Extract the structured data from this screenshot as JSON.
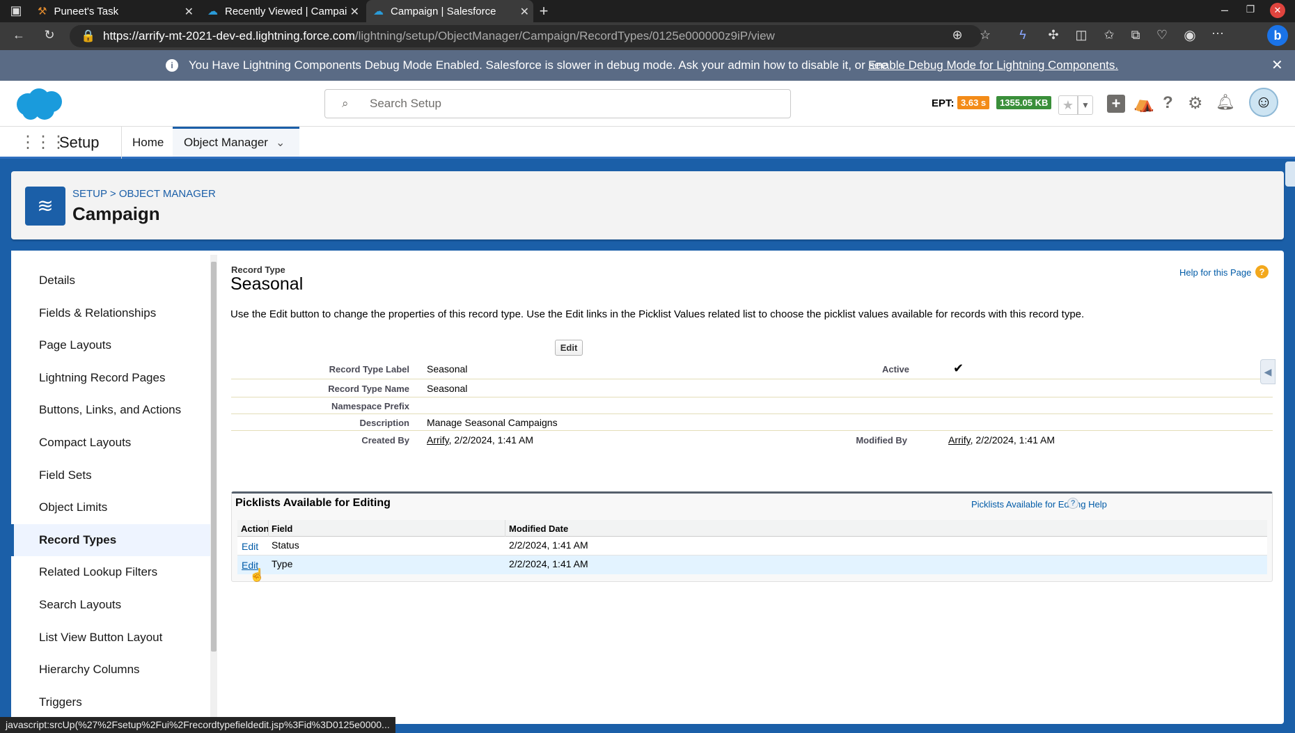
{
  "browser": {
    "tabs": [
      {
        "title": "Puneet's Task"
      },
      {
        "title": "Recently Viewed | Campai"
      },
      {
        "title": "Campaign | Salesforce"
      }
    ],
    "url_main": "https://arrify-mt-2021-dev-ed.lightning.force.com",
    "url_path": "/lightning/setup/ObjectManager/Campaign/RecordTypes/0125e000000z9iP/view",
    "status_url": "javascript:srcUp(%27%2Fsetup%2Fui%2Frecordtypefieldedit.jsp%3Fid%3D0125e0000..."
  },
  "banner": {
    "text": "You Have Lightning Components Debug Mode Enabled. Salesforce is slower in debug mode. Ask your admin how to disable it, or see",
    "link": "Enable Debug Mode for Lightning Components."
  },
  "header": {
    "search_placeholder": "Search Setup",
    "ept_label": "EPT:",
    "ept_time": "3.63 s",
    "ept_size": "1355.05 KB"
  },
  "nav": {
    "app": "Setup",
    "home": "Home",
    "object_manager": "Object Manager"
  },
  "object": {
    "breadcrumb_setup": "SETUP",
    "breadcrumb_sep": ">",
    "breadcrumb_om": "OBJECT MANAGER",
    "title": "Campaign"
  },
  "sidebar": {
    "items": [
      {
        "label": "Details"
      },
      {
        "label": "Fields & Relationships"
      },
      {
        "label": "Page Layouts"
      },
      {
        "label": "Lightning Record Pages"
      },
      {
        "label": "Buttons, Links, and Actions"
      },
      {
        "label": "Compact Layouts"
      },
      {
        "label": "Field Sets"
      },
      {
        "label": "Object Limits"
      },
      {
        "label": "Record Types"
      },
      {
        "label": "Related Lookup Filters"
      },
      {
        "label": "Search Layouts"
      },
      {
        "label": "List View Button Layout"
      },
      {
        "label": "Hierarchy Columns"
      },
      {
        "label": "Triggers"
      }
    ]
  },
  "record": {
    "type_label": "Record Type",
    "name": "Seasonal",
    "help_link": "Help for this Page",
    "description_text": "Use the Edit button to change the properties of this record type. Use the Edit links in the Picklist Values related list to choose the picklist values available for records with this record type.",
    "edit_button": "Edit",
    "fields": {
      "label_label": "Record Type Label",
      "label_value": "Seasonal",
      "active_label": "Active",
      "name_label": "Record Type Name",
      "name_value": "Seasonal",
      "namespace_label": "Namespace Prefix",
      "desc_label": "Description",
      "desc_value": "Manage Seasonal Campaigns",
      "created_label": "Created By",
      "created_user": "Arrify",
      "created_date": ", 2/2/2024, 1:41 AM",
      "modified_label": "Modified By",
      "modified_user": "Arrify",
      "modified_date": ", 2/2/2024, 1:41 AM"
    }
  },
  "picklists": {
    "title": "Picklists Available for Editing",
    "help": "Picklists Available for Editing Help",
    "headers": {
      "action": "Action",
      "field": "Field",
      "modified": "Modified Date"
    },
    "rows": [
      {
        "action": "Edit",
        "field": "Status",
        "modified": "2/2/2024, 1:41 AM"
      },
      {
        "action": "Edit",
        "field": "Type",
        "modified": "2/2/2024, 1:41 AM"
      }
    ]
  }
}
